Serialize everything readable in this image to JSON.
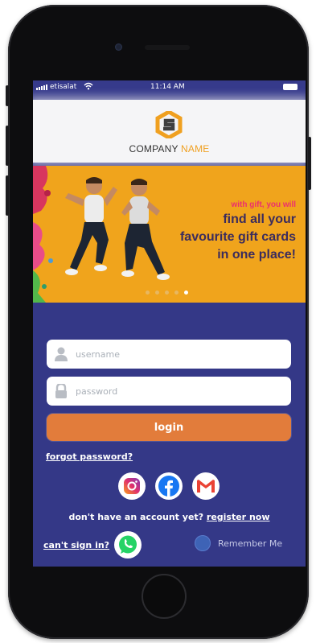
{
  "status_bar": {
    "carrier": "etisalat",
    "time": "11:14 AM"
  },
  "brand": {
    "company_word": "COMPANY",
    "name_word": "NAME",
    "accent_color": "#f0a020"
  },
  "banner": {
    "line1": "with gift, you will",
    "line2": "find all your",
    "line3": "favourite gift cards",
    "line4": "in one place!",
    "slides": 5,
    "active_slide": 5
  },
  "form": {
    "username_placeholder": "username",
    "password_placeholder": "password",
    "login_label": "login",
    "forgot_password": "forgot password?"
  },
  "social": [
    {
      "name": "instagram-icon"
    },
    {
      "name": "facebook-icon"
    },
    {
      "name": "gmail-icon"
    }
  ],
  "footer": {
    "no_account": "don't have an account yet?",
    "register": "register now",
    "cant_sign_in": "can't sign in?",
    "remember_me": "Remember Me"
  },
  "colors": {
    "screen_bg": "#343887",
    "banner_bg": "#f0a41c",
    "button": "#e27c3b",
    "promo_text": "#3b2c5d",
    "promo_pink": "#ec2f6d"
  }
}
